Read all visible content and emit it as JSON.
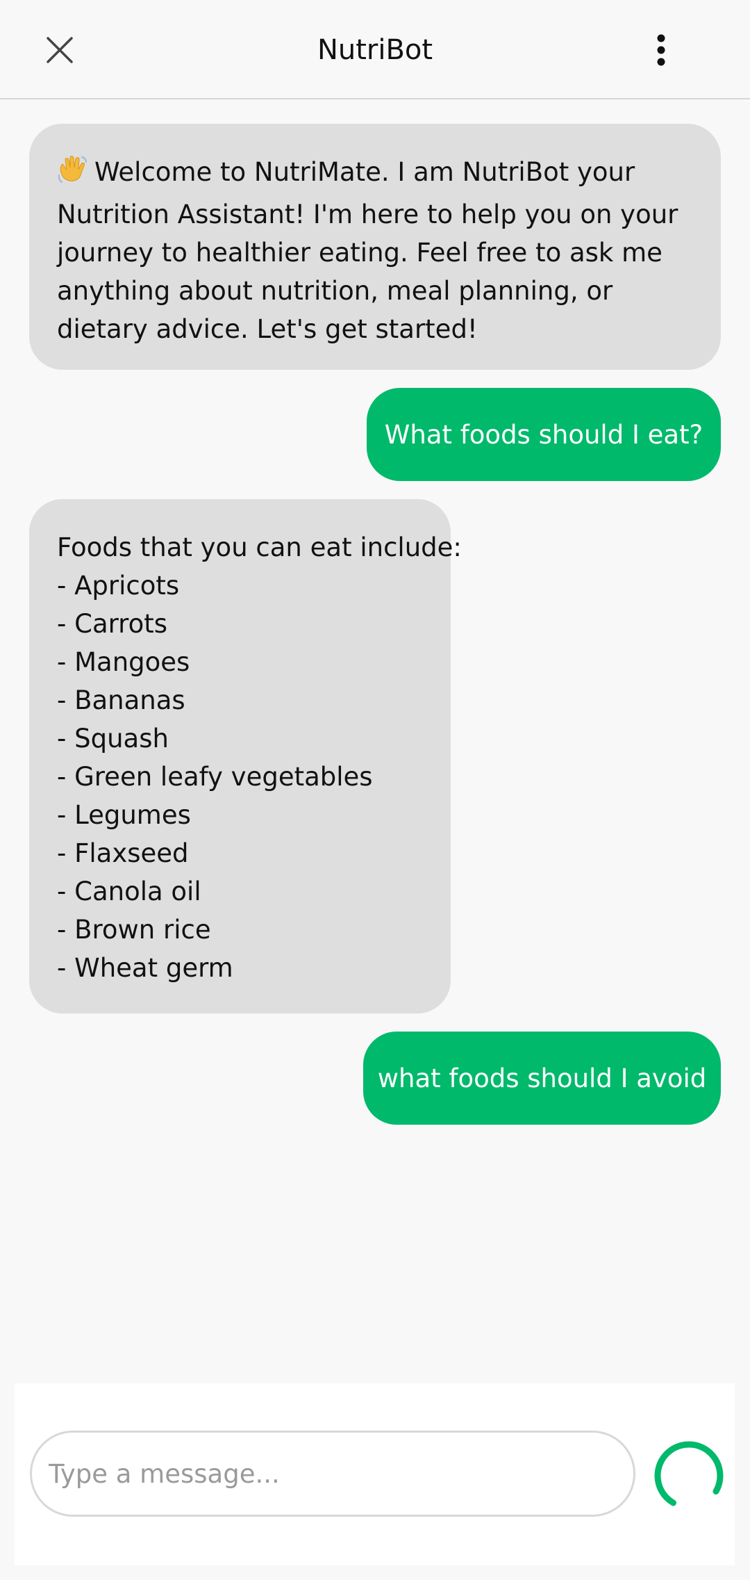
{
  "header": {
    "title": "NutriBot",
    "close_icon": "close-icon",
    "menu_icon": "more-vertical-icon"
  },
  "messages": [
    {
      "sender": "bot",
      "emoji": "👋",
      "text": "Welcome to NutriMate. I am NutriBot your Nutrition Assistant! I'm here to help you on your journey to healthier eating. Feel free to ask me anything about nutrition, meal planning, or dietary advice. Let's get started!"
    },
    {
      "sender": "user",
      "text": "What foods should I eat?"
    },
    {
      "sender": "bot",
      "intro": "Foods that you can eat include:",
      "items": [
        "- Apricots",
        "- Carrots",
        "- Mangoes",
        "- Bananas",
        "- Squash",
        "- Green leafy vegetables",
        "- Legumes",
        "- Flaxseed",
        "- Canola oil",
        "- Brown rice",
        "- Wheat germ"
      ]
    },
    {
      "sender": "user",
      "text": "what foods should I avoid"
    }
  ],
  "composer": {
    "placeholder": "Type a message...",
    "value": "",
    "status_icon": "loading-spinner-icon"
  },
  "colors": {
    "accent": "#00b96b",
    "bot_bubble": "#dedede",
    "background": "#f8f8f8"
  }
}
